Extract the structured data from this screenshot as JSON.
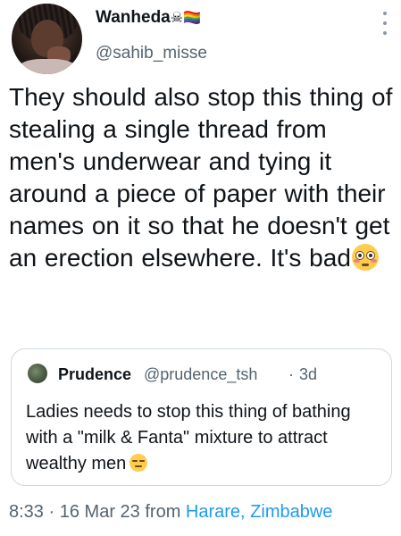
{
  "author": {
    "display_name": "Wanheda",
    "name_emojis": "☠🏳️‍🌈",
    "handle": "@sahib_misse"
  },
  "tweet": {
    "text": "They should also stop this thing of stealing a single thread from men's underwear and tying it around a piece of paper with their names on it so that he doesn't get an erection elsewhere. It's bad",
    "trailing_emoji": "flushed-face"
  },
  "quoted_tweet": {
    "display_name": "Prudence",
    "handle": "@prudence_tsh",
    "separator": "·",
    "time": "3d",
    "text": "Ladies needs to stop this thing of bathing with a \"milk & Fanta\" mixture to attract wealthy men",
    "trailing_emoji": "unamused-face"
  },
  "meta": {
    "time": "8:33",
    "separator": "·",
    "date": "16 Mar 23",
    "from_label": "from",
    "location": "Harare, Zimbabwe"
  },
  "colors": {
    "text": "#0f1419",
    "secondary": "#536471",
    "link": "#1d9bf0",
    "border": "#cfd9de"
  }
}
